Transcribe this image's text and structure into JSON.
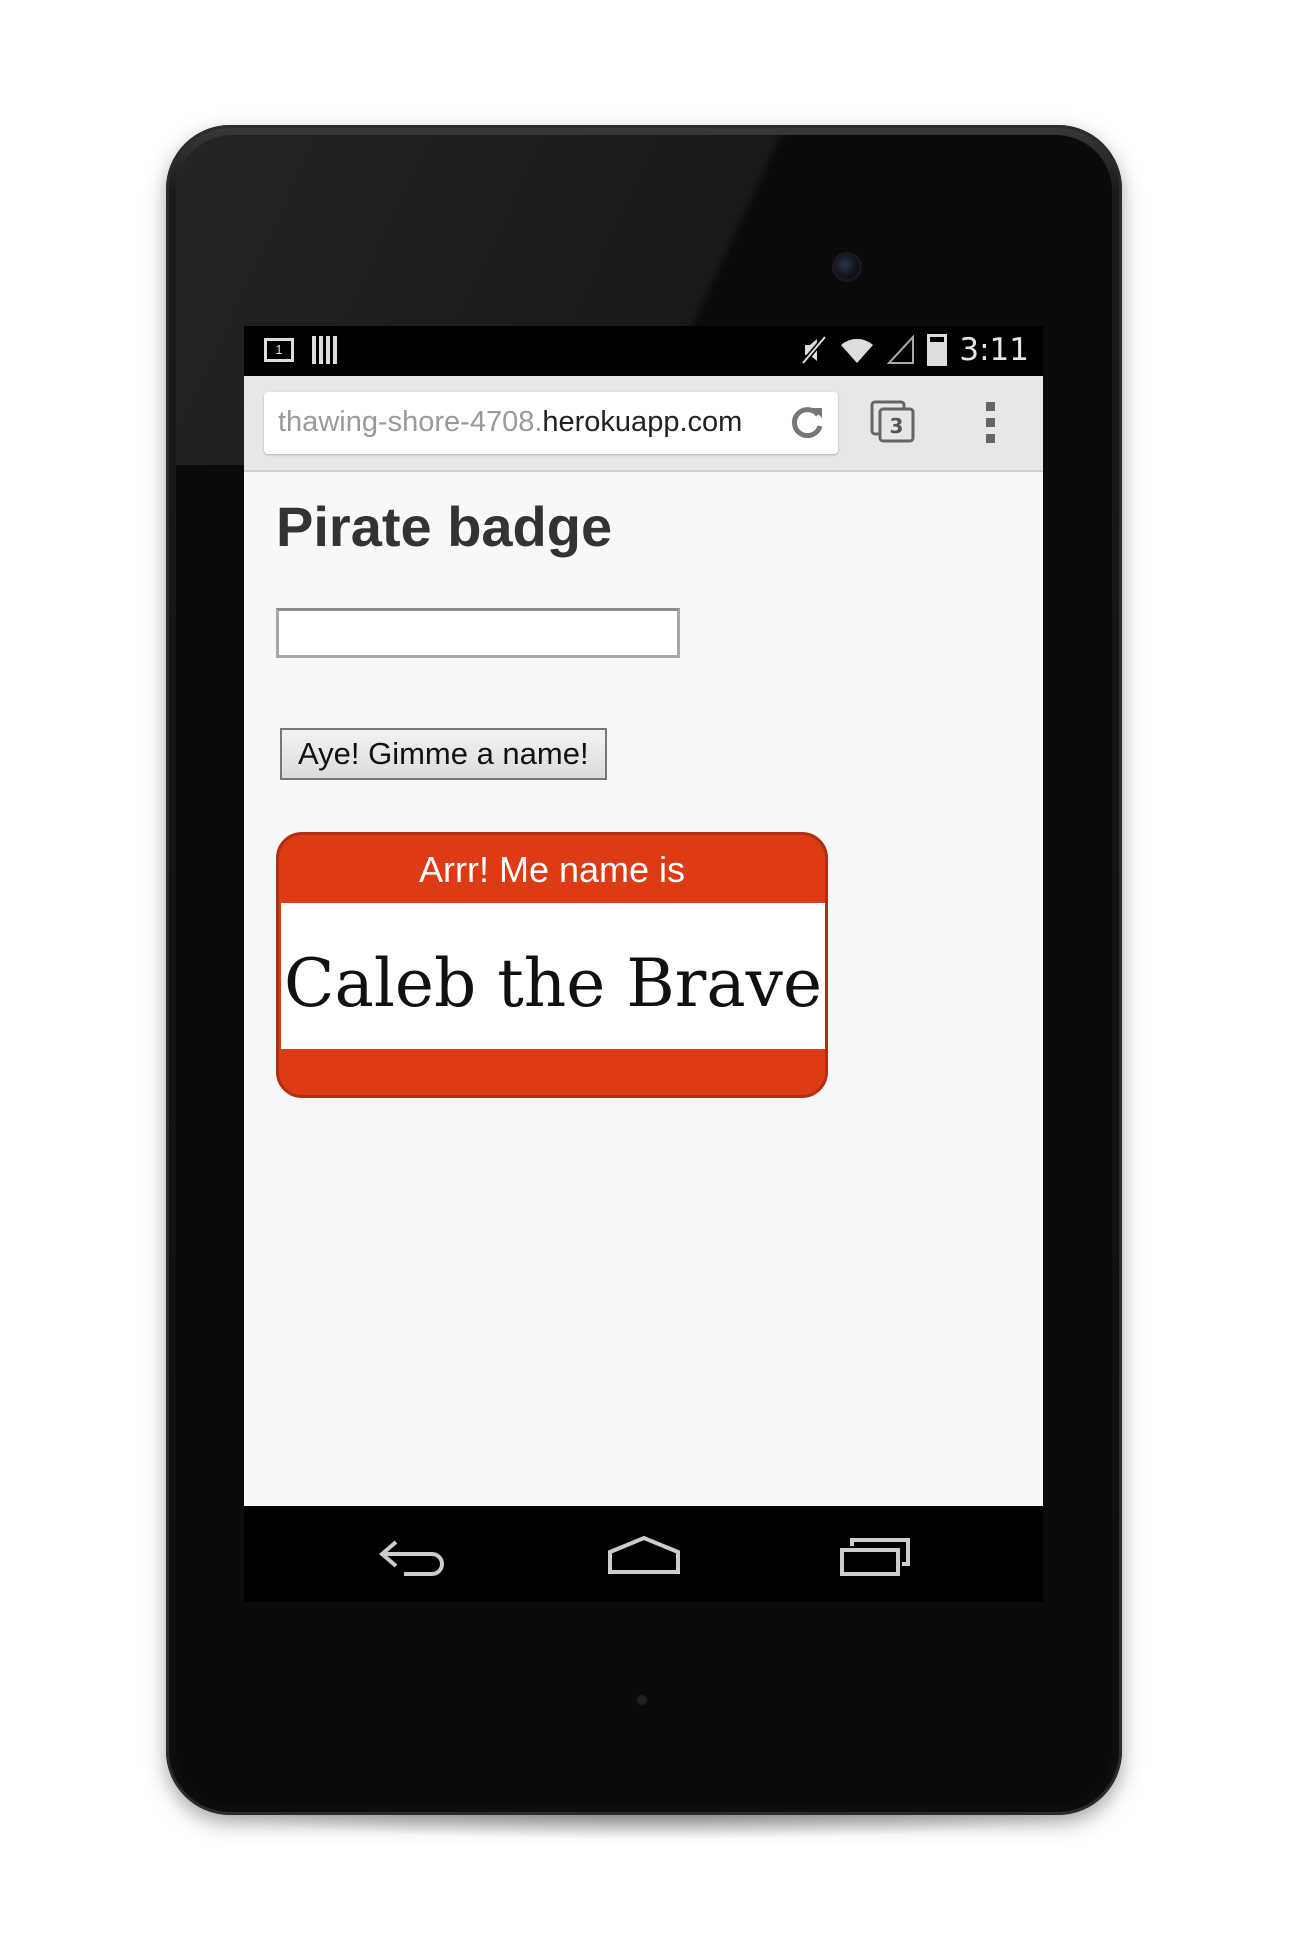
{
  "status_bar": {
    "time": "3:11",
    "notification_count": "1",
    "icons": [
      "notification-icon",
      "barcode-icon",
      "mute-icon",
      "wifi-icon",
      "signal-icon",
      "battery-icon"
    ]
  },
  "browser": {
    "url_subdomain": "thawing-shore-4708.",
    "url_domain": "herokuapp.com",
    "tab_count": "3"
  },
  "page": {
    "title": "Pirate badge",
    "input_value": "",
    "button_label": "Aye! Gimme a name!"
  },
  "badge": {
    "greeting": "Arrr! Me name is",
    "name": "Caleb the Brave",
    "color": "#dd3a16"
  },
  "nav_bar": {
    "icons": [
      "back-icon",
      "home-icon",
      "recent-apps-icon"
    ]
  }
}
